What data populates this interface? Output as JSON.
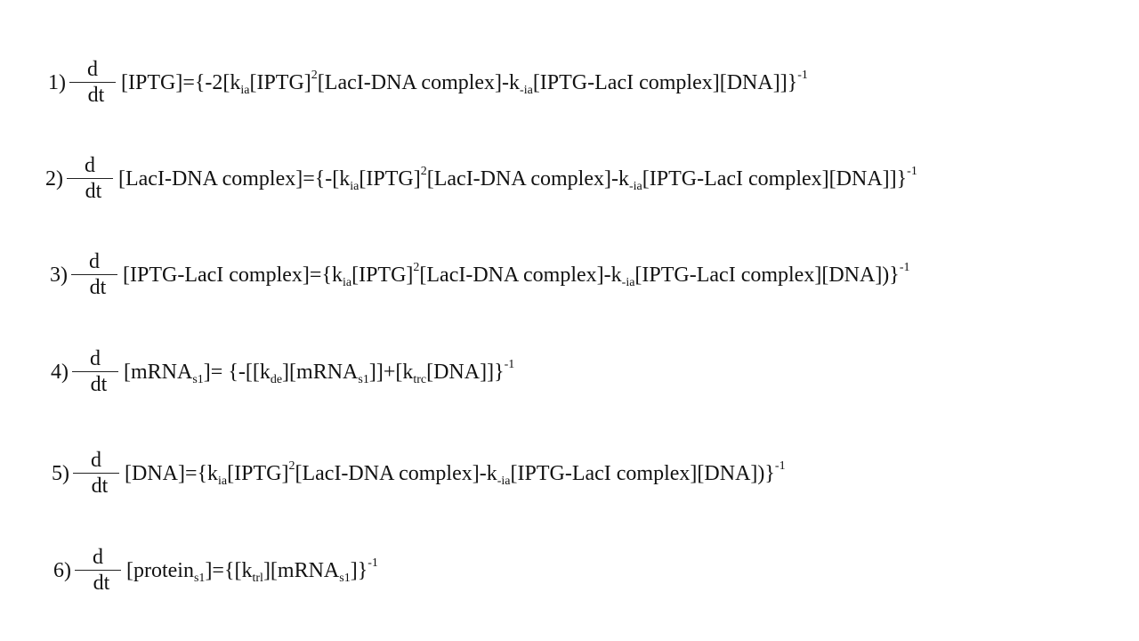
{
  "equations": [
    {
      "number": "1)",
      "numerator": "d",
      "denominator": "dt",
      "rhs": [
        [
          "t",
          "[IPTG]={-2[k"
        ],
        [
          "sub",
          "ia"
        ],
        [
          "t",
          "[IPTG]"
        ],
        [
          "sup",
          "2"
        ],
        [
          "t",
          "[LacI-DNA complex]-k"
        ],
        [
          "sub",
          "-ia"
        ],
        [
          "t",
          "[IPTG-LacI complex][DNA]]}"
        ],
        [
          "sup",
          "-1"
        ]
      ]
    },
    {
      "number": "2)",
      "numerator": "d",
      "denominator": "dt",
      "rhs": [
        [
          "t",
          "[LacI-DNA complex]={-[k"
        ],
        [
          "sub",
          "ia"
        ],
        [
          "t",
          "[IPTG]"
        ],
        [
          "sup",
          "2"
        ],
        [
          "t",
          "[LacI-DNA complex]-k"
        ],
        [
          "sub",
          "-ia"
        ],
        [
          "t",
          "[IPTG-LacI complex][DNA]]}"
        ],
        [
          "sup",
          "-1"
        ]
      ]
    },
    {
      "number": "3)",
      "numerator": "d",
      "denominator": "dt",
      "rhs": [
        [
          "t",
          "[IPTG-LacI complex]={k"
        ],
        [
          "sub",
          "ia"
        ],
        [
          "t",
          "[IPTG]"
        ],
        [
          "sup",
          "2"
        ],
        [
          "t",
          "[LacI-DNA complex]-k"
        ],
        [
          "sub",
          "-ia"
        ],
        [
          "t",
          "[IPTG-LacI complex][DNA])}"
        ],
        [
          "sup",
          "-1"
        ]
      ]
    },
    {
      "number": "4)",
      "numerator": "d",
      "denominator": "dt",
      "rhs": [
        [
          "t",
          "[mRNA"
        ],
        [
          "sub",
          "s1"
        ],
        [
          "t",
          "]= {-[[k"
        ],
        [
          "sub",
          "de"
        ],
        [
          "t",
          "][mRNA"
        ],
        [
          "sub",
          "s1"
        ],
        [
          "t",
          "]]+[k"
        ],
        [
          "sub",
          "trc"
        ],
        [
          "t",
          "[DNA]]}"
        ],
        [
          "sup",
          "-1"
        ]
      ]
    },
    {
      "number": "5)",
      "numerator": "d",
      "denominator": "dt",
      "rhs": [
        [
          "t",
          "[DNA]={k"
        ],
        [
          "sub",
          "ia"
        ],
        [
          "t",
          "[IPTG]"
        ],
        [
          "sup",
          "2"
        ],
        [
          "t",
          "[LacI-DNA complex]-k"
        ],
        [
          "sub",
          "-ia"
        ],
        [
          "t",
          "[IPTG-LacI complex][DNA])}"
        ],
        [
          "sup",
          "-1"
        ]
      ]
    },
    {
      "number": "6)",
      "numerator": "d",
      "denominator": "dt",
      "rhs": [
        [
          "t",
          "[protein"
        ],
        [
          "sub",
          "s1"
        ],
        [
          "t",
          "]={[k"
        ],
        [
          "sub",
          "trl"
        ],
        [
          "t",
          "][mRNA"
        ],
        [
          "sub",
          "s1"
        ],
        [
          "t",
          "]}"
        ],
        [
          "sup",
          "-1"
        ]
      ]
    }
  ]
}
